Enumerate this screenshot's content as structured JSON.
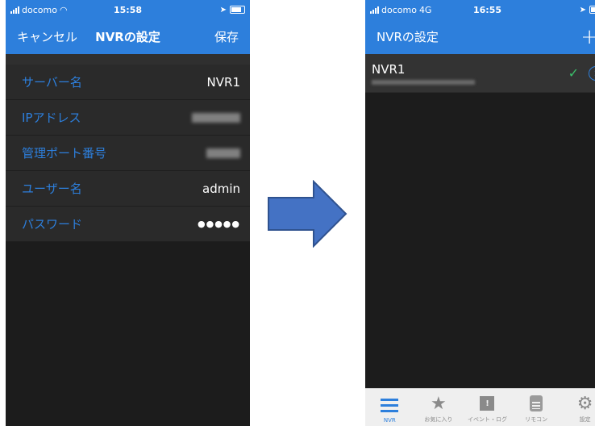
{
  "left_screen": {
    "status": {
      "carrier": "docomo",
      "time": "15:58"
    },
    "nav": {
      "cancel_label": "キャンセル",
      "title": "NVRの設定",
      "save_label": "保存"
    },
    "rows": [
      {
        "label": "サーバー名",
        "value": "NVR1"
      },
      {
        "label": "IPアドレス",
        "value": ""
      },
      {
        "label": "管理ポート番号",
        "value": ""
      },
      {
        "label": "ユーザー名",
        "value": "admin"
      },
      {
        "label": "パスワード",
        "value": "●●●●●"
      }
    ]
  },
  "right_screen": {
    "status": {
      "carrier": "docomo",
      "network": "4G",
      "time": "16:55"
    },
    "nav": {
      "title": "NVRの設定",
      "add_icon": "plus-icon"
    },
    "list": [
      {
        "name": "NVR1",
        "checked_icon": "checkmark-icon",
        "info_icon": "info-icon"
      }
    ],
    "tabs": [
      {
        "label": "NVR",
        "icon": "list-icon",
        "active": true
      },
      {
        "label": "お気に入り",
        "icon": "star-icon",
        "active": false
      },
      {
        "label": "イベント・ログ",
        "icon": "event-flag-icon",
        "active": false
      },
      {
        "label": "リモコン",
        "icon": "remote-icon",
        "active": false
      },
      {
        "label": "設定",
        "icon": "gear-icon",
        "active": false
      }
    ]
  },
  "colors": {
    "accent": "#2d7fdc",
    "background": "#1c1c1c",
    "check": "#3bbf6a"
  },
  "arrow_icon": "right-arrow-icon"
}
